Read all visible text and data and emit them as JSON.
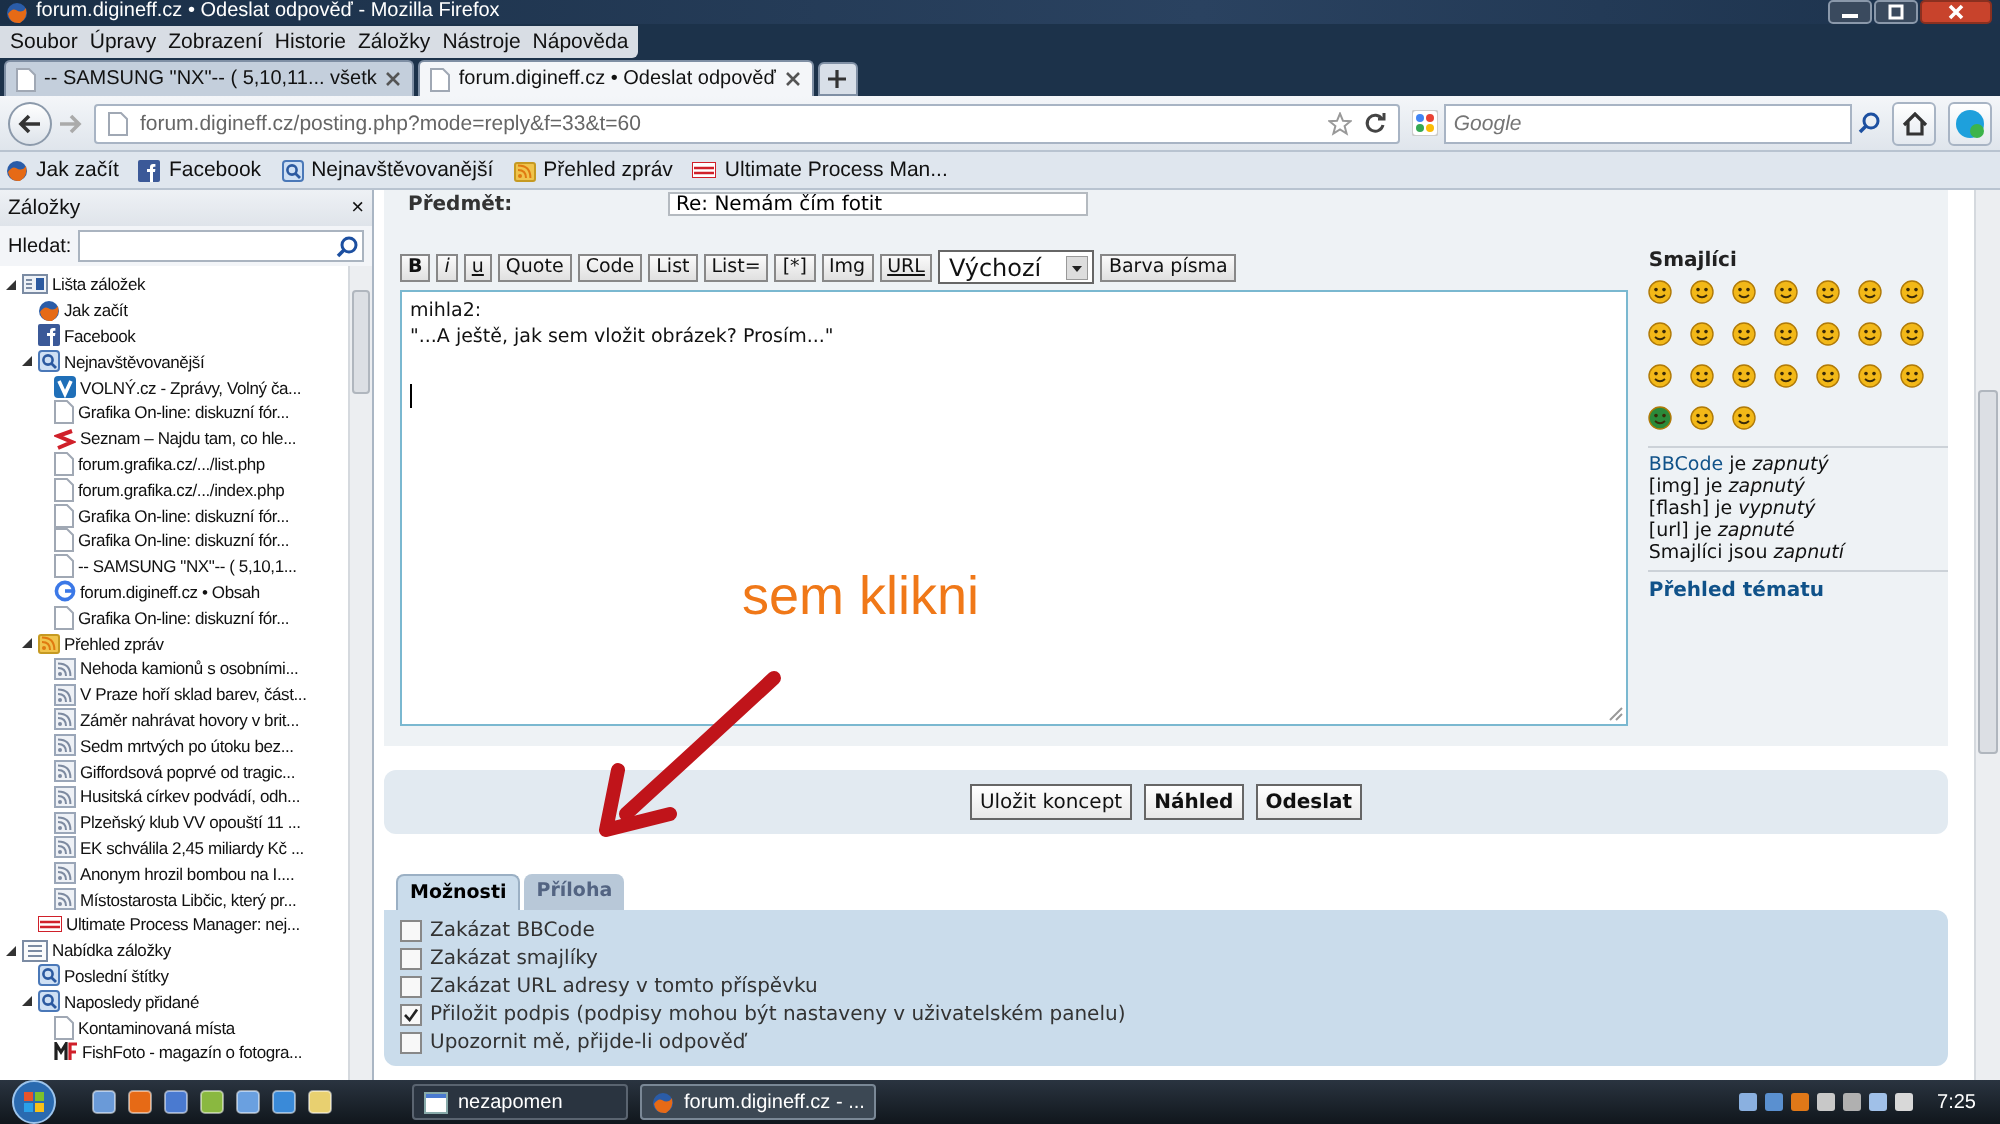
{
  "window": {
    "title": "forum.digineff.cz • Odeslat odpověď - Mozilla Firefox"
  },
  "menu": [
    "Soubor",
    "Úpravy",
    "Zobrazení",
    "Historie",
    "Záložky",
    "Nástroje",
    "Nápověda"
  ],
  "tabs": [
    {
      "label": "-- SAMSUNG \"NX\"-- ( 5,10,11... všetk",
      "selected": false
    },
    {
      "label": "forum.digineff.cz • Odeslat odpověď",
      "selected": true
    }
  ],
  "address": {
    "value": "forum.digineff.cz/posting.php?mode=reply&f=33&t=60"
  },
  "search": {
    "placeholder": "Google"
  },
  "bookmarks_bar": [
    {
      "label": "Jak začít",
      "kind": "firefox"
    },
    {
      "label": "Facebook",
      "kind": "facebook"
    },
    {
      "label": "Nejnavštěvovanější",
      "kind": "query"
    },
    {
      "label": "Přehled zpráv",
      "kind": "rss"
    },
    {
      "label": "Ultimate Process Man...",
      "kind": "logo"
    }
  ],
  "sidebar": {
    "title": "Záložky",
    "close": "×",
    "search_label": "Hledat:",
    "items": [
      {
        "label": "Lišta záložek",
        "kind": "toolbar",
        "expanded": true,
        "children": [
          {
            "label": "Jak začít",
            "kind": "firefox"
          },
          {
            "label": "Facebook",
            "kind": "facebook"
          },
          {
            "label": "Nejnavštěvovanější",
            "kind": "query",
            "expanded": true,
            "children": [
              {
                "label": "VOLNÝ.cz - Zprávy, Volný ča...",
                "kind": "volny"
              },
              {
                "label": "Grafika On-line: diskuzní fór...",
                "kind": "page"
              },
              {
                "label": "Seznam – Najdu tam, co hle...",
                "kind": "seznam"
              },
              {
                "label": "forum.grafika.cz/.../list.php",
                "kind": "page"
              },
              {
                "label": "forum.grafika.cz/.../index.php",
                "kind": "page"
              },
              {
                "label": "Grafika On-line: diskuzní fór...",
                "kind": "page"
              },
              {
                "label": "Grafika On-line: diskuzní fór...",
                "kind": "page"
              },
              {
                "label": "-- SAMSUNG \"NX\"-- ( 5,10,1...",
                "kind": "page"
              },
              {
                "label": "forum.digineff.cz • Obsah",
                "kind": "google"
              },
              {
                "label": "Grafika On-line: diskuzní fór...",
                "kind": "page"
              }
            ]
          },
          {
            "label": "Přehled zpráv",
            "kind": "rss",
            "expanded": true,
            "children": [
              {
                "label": "Nehoda kamionů s osobními...",
                "kind": "feed"
              },
              {
                "label": "V Praze hoří sklad barev, část...",
                "kind": "feed"
              },
              {
                "label": "Záměr nahrávat hovory v brit...",
                "kind": "feed"
              },
              {
                "label": "Sedm mrtvých po útoku bez...",
                "kind": "feed"
              },
              {
                "label": "Giffordsová poprvé od tragic...",
                "kind": "feed"
              },
              {
                "label": "Husitská církev podvádí, odh...",
                "kind": "feed"
              },
              {
                "label": "Plzeňský klub VV opouští 11 ...",
                "kind": "feed"
              },
              {
                "label": "EK schválila 2,45 miliardy Kč ...",
                "kind": "feed"
              },
              {
                "label": "Anonym hrozil bombou na I....",
                "kind": "feed"
              },
              {
                "label": "Místostarosta Libčic, který pr...",
                "kind": "feed"
              }
            ]
          },
          {
            "label": "Ultimate Process Manager: nej...",
            "kind": "logo"
          }
        ]
      },
      {
        "label": "Nabídka záložky",
        "kind": "menu",
        "expanded": true,
        "children": [
          {
            "label": "Poslední štítky",
            "kind": "query"
          },
          {
            "label": "Naposledy přidané",
            "kind": "query",
            "expanded": true,
            "children": [
              {
                "label": "Kontaminovaná místa",
                "kind": "page"
              },
              {
                "label": "FishFoto - magazín o fotogra...",
                "kind": "mf"
              }
            ]
          }
        ]
      }
    ]
  },
  "form": {
    "subject_label": "Předmět:",
    "subject": "Re: Nemám čím fotit",
    "format_buttons": [
      "B",
      "i",
      "u",
      "Quote",
      "Code",
      "List",
      "List=",
      "[*]",
      "Img",
      "URL"
    ],
    "font_size": "Výchozí",
    "color_button": "Barva písma",
    "message_lines": [
      "mihla2:",
      "\"...A ještě, jak sem vložit obrázek? Prosím...\""
    ],
    "submit_buttons": [
      {
        "label": "Uložit koncept",
        "primary": false
      },
      {
        "label": "Náhled",
        "primary": true
      },
      {
        "label": "Odeslat",
        "primary": true
      }
    ],
    "option_tabs": [
      {
        "label": "Možnosti",
        "selected": true
      },
      {
        "label": "Příloha",
        "selected": false
      }
    ],
    "options": [
      {
        "label": "Zakázat BBCode",
        "checked": false
      },
      {
        "label": "Zakázat smajlíky",
        "checked": false
      },
      {
        "label": "Zakázat URL adresy v tomto příspěvku",
        "checked": false
      },
      {
        "label": "Přiložit podpis (podpisy mohou být nastaveny v uživatelském panelu)",
        "checked": true
      },
      {
        "label": "Upozornit mě, přijde-li odpověď",
        "checked": false
      }
    ]
  },
  "smilies": {
    "title": "Smajlíci",
    "status": [
      {
        "link": "BBCode",
        "text": "je *zapnutý*"
      },
      {
        "text": "[img] je *zapnutý*"
      },
      {
        "text": "[flash] je *vypnutý*"
      },
      {
        "text": "[url] je *zapnuté*"
      },
      {
        "text": "Smajlíci jsou *zapnutí*"
      }
    ],
    "topic_link": "Přehled tématu"
  },
  "annotation": {
    "text": "sem klikni"
  },
  "taskbar": {
    "tasks": [
      {
        "label": "nezapomen",
        "selected": false
      },
      {
        "label": "forum.digineff.cz - ...",
        "selected": true
      }
    ],
    "clock": "7:25"
  }
}
